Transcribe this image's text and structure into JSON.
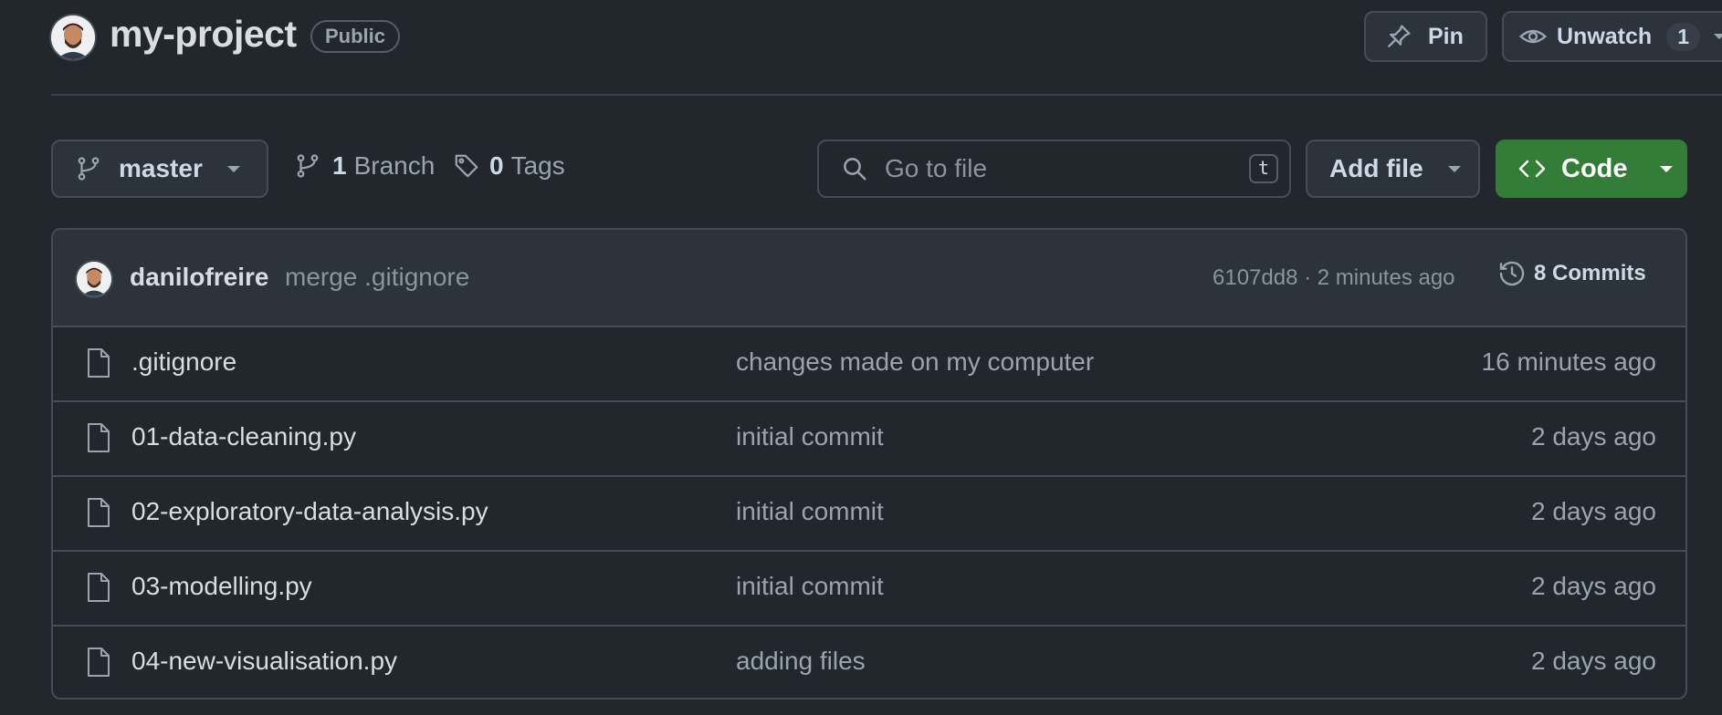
{
  "repo": {
    "name": "my-project",
    "visibility": "Public"
  },
  "actions": {
    "pin_label": "Pin",
    "unwatch_label": "Unwatch",
    "watch_count": "1"
  },
  "toolbar": {
    "branch_name": "master",
    "branch_count": "1",
    "branch_label": "Branch",
    "tag_count": "0",
    "tag_label": "Tags",
    "search_placeholder": "Go to file",
    "search_shortcut": "t",
    "add_file_label": "Add file",
    "code_label": "Code"
  },
  "latest_commit": {
    "author": "danilofreire",
    "message": "merge .gitignore",
    "hash_time": "6107dd8 · 2 minutes ago",
    "commits_label": "8 Commits"
  },
  "files": [
    {
      "name": ".gitignore",
      "message": "changes made on my computer",
      "time": "16 minutes ago"
    },
    {
      "name": "01-data-cleaning.py",
      "message": "initial commit",
      "time": "2 days ago"
    },
    {
      "name": "02-exploratory-data-analysis.py",
      "message": "initial commit",
      "time": "2 days ago"
    },
    {
      "name": "03-modelling.py",
      "message": "initial commit",
      "time": "2 days ago"
    },
    {
      "name": "04-new-visualisation.py",
      "message": "adding files",
      "time": "2 days ago"
    }
  ],
  "icons": {
    "pin": "pin-icon",
    "eye": "eye-icon",
    "branch": "git-branch-icon",
    "tag": "tag-icon",
    "search": "search-icon",
    "code": "code-icon",
    "history": "history-icon",
    "file": "file-icon",
    "caret": "triangle-down-icon"
  },
  "colors": {
    "background": "#22272e",
    "code_button": "#347d39",
    "border": "#444c56"
  }
}
